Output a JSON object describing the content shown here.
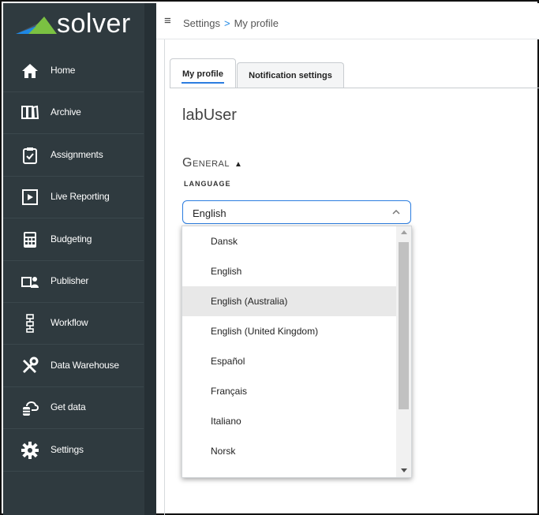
{
  "brand": {
    "name": "solver",
    "accent": "#1e88e5",
    "logo_green": "#7bc142"
  },
  "sidebar": {
    "items": [
      {
        "label": "Home",
        "icon": "home-icon"
      },
      {
        "label": "Archive",
        "icon": "archive-icon"
      },
      {
        "label": "Assignments",
        "icon": "clipboard-icon"
      },
      {
        "label": "Live Reporting",
        "icon": "live-reporting-icon"
      },
      {
        "label": "Budgeting",
        "icon": "calculator-icon"
      },
      {
        "label": "Publisher",
        "icon": "publisher-icon"
      },
      {
        "label": "Workflow",
        "icon": "workflow-icon"
      },
      {
        "label": "Data Warehouse",
        "icon": "tools-icon"
      },
      {
        "label": "Get data",
        "icon": "cloud-database-icon"
      },
      {
        "label": "Settings",
        "icon": "gear-icon"
      }
    ]
  },
  "topbar": {
    "crumb_root": "Settings",
    "crumb_separator": ">",
    "crumb_current": "My profile"
  },
  "tabs": [
    {
      "label": "My profile"
    },
    {
      "label": "Notification settings"
    }
  ],
  "profile": {
    "username": "labUser",
    "section_title": "General",
    "language_label": "LANGUAGE",
    "language_value": "English"
  },
  "dropdown": {
    "options": [
      "Dansk",
      "English",
      "English (Australia)",
      "English (United Kingdom)",
      "Español",
      "Français",
      "Italiano",
      "Norsk"
    ],
    "highlighted": "English (Australia)"
  }
}
